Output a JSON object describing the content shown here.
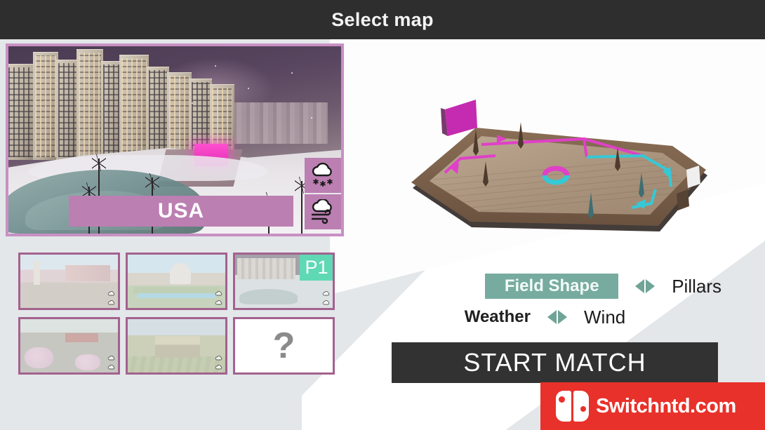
{
  "header": {
    "title": "Select map"
  },
  "preview": {
    "map_name": "USA",
    "weather_icons": [
      "snow-cloud-icon",
      "wind-cloud-icon"
    ]
  },
  "thumbnails": [
    {
      "name": "map-thumb-1",
      "scene": "sc1",
      "badge": null,
      "weather_icons": [
        "cloud-icon",
        "cloud-icon"
      ]
    },
    {
      "name": "map-thumb-2",
      "scene": "sc2",
      "badge": null,
      "weather_icons": [
        "cloud-icon",
        "cloud-icon"
      ]
    },
    {
      "name": "map-thumb-3",
      "scene": "sc3",
      "badge": "P1",
      "weather_icons": [
        "cloud-icon",
        "cloud-icon"
      ]
    },
    {
      "name": "map-thumb-4",
      "scene": "sc4",
      "badge": null,
      "weather_icons": [
        "cloud-icon",
        "cloud-icon"
      ]
    },
    {
      "name": "map-thumb-5",
      "scene": "sc5",
      "badge": null,
      "weather_icons": [
        "cloud-icon",
        "cloud-icon"
      ]
    },
    {
      "name": "map-thumb-mystery",
      "scene": "mystery",
      "badge": null,
      "mark": "?"
    }
  ],
  "options": [
    {
      "label": "Field Shape",
      "value": "Pillars",
      "selected": true
    },
    {
      "label": "Weather",
      "value": "Wind",
      "selected": false
    }
  ],
  "start_button": {
    "label": "START MATCH"
  },
  "watermark": {
    "text": "Switchntd.com",
    "brand_color": "#e8312a"
  },
  "colors": {
    "header_bg": "#2e2e2e",
    "page_bg": "#e3e7e9",
    "preview_border": "#c890c4",
    "banner_bg": "#bb7fb2",
    "thumb_border": "#a3628f",
    "badge_bg": "#5fd9b4",
    "option_selected_bg": "#77ab9f",
    "arrow_color": "#6fa497",
    "start_bg": "#323232",
    "field_pink": "#e040c8",
    "field_cyan": "#35c9d6"
  }
}
